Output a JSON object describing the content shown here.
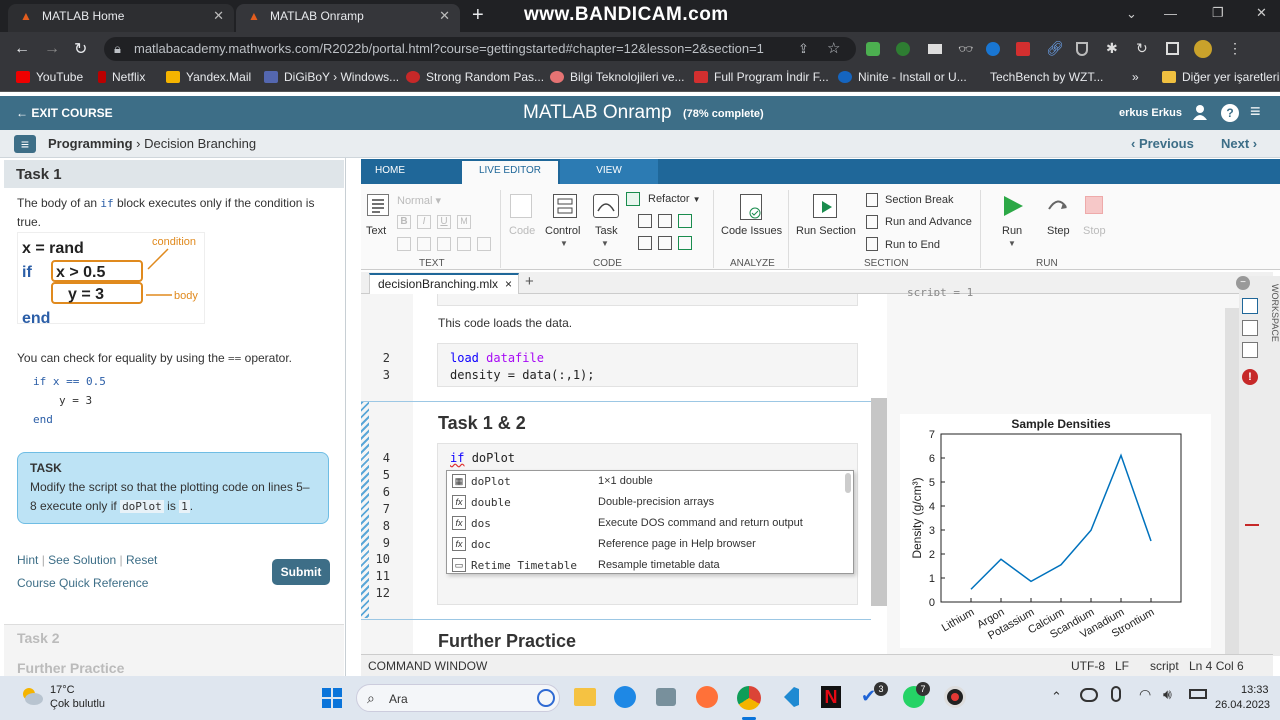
{
  "browser": {
    "tabs": [
      {
        "label": "MATLAB Home"
      },
      {
        "label": "MATLAB Onramp"
      }
    ],
    "url": "matlabacademy.mathworks.com/R2022b/portal.html?course=gettingstarted#chapter=12&lesson=2&section=1",
    "watermark": "www.BANDICAM.com",
    "bookmarks": [
      "YouTube",
      "Netflix",
      "Yandex.Mail",
      "DiGiBoY › Windows...",
      "Strong Random Pas...",
      "Bilgi Teknolojileri ve...",
      "Full Program İndir F...",
      "Ninite - Install or U...",
      "TechBench by WZT...",
      "Diğer yer işaretleri"
    ]
  },
  "app": {
    "exit": "EXIT COURSE",
    "title": "MATLAB Onramp",
    "progress": "(78% complete)",
    "user": "erkus Erkus",
    "breadcrumb_bold": "Programming",
    "breadcrumb_sep": "›",
    "breadcrumb_page": "Decision Branching",
    "prev": "‹ Previous",
    "next": "Next ›"
  },
  "left": {
    "task_title": "Task 1",
    "p1_a": "The body of an",
    "p1_code": "if",
    "p1_b": "block executes only if the condition is true.",
    "diag": {
      "l1": "x = rand",
      "l2a": "if",
      "l2b": "x > 0.5",
      "l3": "y = 3",
      "l4": "end",
      "cond": "condition",
      "body": "body"
    },
    "p2_a": "You can check for equality by using the",
    "p2_code": "==",
    "p2_b": "operator.",
    "ex1": "if x == 0.5",
    "ex2": "y = 3",
    "ex3": "end",
    "task_label": "TASK",
    "task_text_a": "Modify the script so that the plotting code on lines 5–8 execute only if",
    "task_code1": "doPlot",
    "task_is": "is",
    "task_code2": "1",
    "task_dot": ".",
    "hint": "Hint",
    "solution": "See Solution",
    "reset": "Reset",
    "ref": "Course Quick Reference",
    "submit": "Submit",
    "task2": "Task 2",
    "further": "Further Practice"
  },
  "ribbon": {
    "tabs": [
      "HOME",
      "LIVE EDITOR",
      "VIEW"
    ],
    "text_btn": "Text",
    "normal": "Normal",
    "code_btn": "Code",
    "control": "Control",
    "task": "Task",
    "refactor": "Refactor",
    "code_issues": "Code Issues",
    "run_section": "Run Section",
    "section_break": "Section Break",
    "run_advance": "Run and Advance",
    "run_end": "Run to End",
    "run": "Run",
    "step": "Step",
    "stop": "Stop",
    "sections": [
      "TEXT",
      "CODE",
      "ANALYZE",
      "SECTION",
      "RUN"
    ]
  },
  "editor": {
    "file_tab": "decisionBranching.mlx",
    "file_close": "×",
    "add_tab": "+",
    "note": "This code loads the data.",
    "line2_kw": "load",
    "line2_var": "datafile",
    "line3": "density = data(:,1);",
    "heading": "Task 1 & 2",
    "line4_kw": "if",
    "line4_rest": "doPlot",
    "line_numbers": [
      "2",
      "3",
      "4",
      "5",
      "6",
      "7",
      "8",
      "9",
      "10",
      "11",
      "12"
    ],
    "heading2": "Further Practice",
    "autocomplete": [
      {
        "icon": "grid",
        "name": "doPlot",
        "desc": "1×1 double"
      },
      {
        "icon": "fx",
        "name": "double",
        "desc": "Double-precision arrays"
      },
      {
        "icon": "fx",
        "name": "dos",
        "desc": "Execute DOS command and return output"
      },
      {
        "icon": "fx",
        "name": "doc",
        "desc": "Reference page in Help browser"
      },
      {
        "icon": "fx",
        "name": "Retime Timetable",
        "desc": "Resample timetable data"
      }
    ],
    "output_top": "script = 1",
    "workspace": "WORKSPACE"
  },
  "chart_data": {
    "type": "line",
    "title": "Sample Densities",
    "xlabel": "",
    "ylabel": "Density (g/cm³)",
    "categories": [
      "Lithium",
      "Argon",
      "Potassium",
      "Calcium",
      "Scandium",
      "Vanadium",
      "Strontium"
    ],
    "values": [
      0.53,
      1.78,
      0.86,
      1.55,
      2.99,
      6.11,
      2.54
    ],
    "ylim": [
      0,
      7
    ],
    "yticks": [
      "0",
      "1",
      "2",
      "3",
      "4",
      "5",
      "6",
      "7"
    ],
    "color": "#0072bd",
    "grid": false
  },
  "status": {
    "command_window": "COMMAND WINDOW",
    "encoding": "UTF-8",
    "eol": "LF",
    "type": "script",
    "pos": "Ln 4 Col 6"
  },
  "taskbar": {
    "temp": "17°C",
    "weather": "Çok bulutlu",
    "search": "Ara",
    "time": "13:33",
    "date": "26.04.2023",
    "badge_a": "3",
    "badge_b": "7"
  }
}
